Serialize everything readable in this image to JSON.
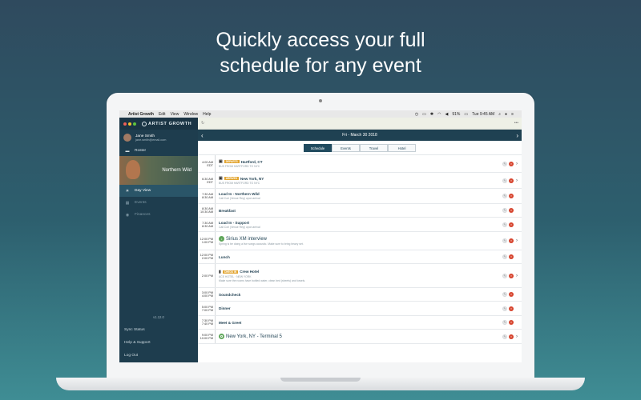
{
  "headline": {
    "line1": "Quickly access your full",
    "line2": "schedule for any event"
  },
  "menubar": {
    "apple": "",
    "app_name": "Artist Growth",
    "items": [
      "Edit",
      "View",
      "Window",
      "Help"
    ],
    "battery": "91%",
    "clock": "Tue 9:45 AM"
  },
  "sidebar": {
    "brand": "ARTIST GROWTH",
    "traffic_lights": [
      "#ec5f57",
      "#f5bf2e",
      "#5fc43d"
    ],
    "user": {
      "name": "Jane Smith",
      "email": "jane.smith@email.com"
    },
    "roster_label": "Roster",
    "band_name": "Northern Wild",
    "nav": [
      {
        "label": "Day View",
        "icon": "sun-icon"
      },
      {
        "label": "Events",
        "icon": "calendar-icon"
      },
      {
        "label": "Finances",
        "icon": "finance-icon"
      }
    ],
    "version": "v1.12.0",
    "footer": [
      "Sync Status",
      "Help & Support",
      "Log Out"
    ]
  },
  "main": {
    "date": "Fri - March 30 2018",
    "tabs": [
      "Schedule",
      "Events",
      "Travel",
      "Hotel"
    ],
    "active_tab": "Schedule",
    "rows": [
      {
        "time1": "4:00 AM",
        "time2": "EDT",
        "icon": "bus-icon",
        "badge": "DEPARTS",
        "title": "Hartford, CT",
        "sub": "BUS FROM HARTFORD TO NYC",
        "big": false,
        "height": 22
      },
      {
        "time1": "6:30 AM",
        "time2": "EDT",
        "icon": "bus-icon",
        "badge": "ARRIVES",
        "title": "New York, NY",
        "sub": "BUS FROM HARTFORD TO NYC",
        "big": false,
        "height": 20
      },
      {
        "time1": "7:30 AM",
        "time2": "8:30 AM",
        "icon": "",
        "badge": "",
        "title": "Load In - Northern Wild",
        "sub": "Call Cori (Venue Rep) upon arrival",
        "big": false,
        "height": 19
      },
      {
        "time1": "8:30 AM",
        "time2": "10:30 AM",
        "icon": "",
        "badge": "",
        "title": "Breakfast",
        "sub": "",
        "big": false,
        "height": 17
      },
      {
        "time1": "7:30 AM",
        "time2": "8:30 AM",
        "icon": "",
        "badge": "",
        "title": "Load In - Support",
        "sub": "Call Cori (Venue Rep) upon arrival",
        "big": false,
        "height": 18
      },
      {
        "time1": "12:00 PM",
        "time2": "1:00 PM",
        "icon": "radio-icon",
        "badge": "",
        "title": "Sirius XM interview",
        "sub": "Spring is be doing a live songs acoustic. Make sure to bring heavy set.",
        "big": true,
        "height": 23
      },
      {
        "time1": "12:00 PM",
        "time2": "2:00 PM",
        "icon": "",
        "badge": "",
        "title": "Lunch",
        "sub": "",
        "big": false,
        "height": 17
      },
      {
        "time1": "2:00 PM",
        "time2": "",
        "icon": "hotel-icon",
        "badge": "CHECK IN",
        "title": "Crew Hotel",
        "sub": "ACE HOTEL · NEW YORK",
        "sub2": "Make sure the rooms have bottled water, clean bed (sheets) and towels.",
        "big": false,
        "height": 30
      },
      {
        "time1": "3:00 PM",
        "time2": "4:00 PM",
        "icon": "",
        "badge": "",
        "title": "Soundcheck",
        "sub": "",
        "big": false,
        "height": 17
      },
      {
        "time1": "5:00 PM",
        "time2": "7:00 PM",
        "icon": "",
        "badge": "",
        "title": "Dinner",
        "sub": "",
        "big": false,
        "height": 18
      },
      {
        "time1": "7:30 PM",
        "time2": "7:40 PM",
        "icon": "",
        "badge": "",
        "title": "Meet & Greet",
        "sub": "",
        "big": false,
        "height": 17
      },
      {
        "time1": "9:00 PM",
        "time2": "10:00 PM",
        "icon": "venue-icon",
        "badge": "",
        "title": "New York, NY - Terminal 5",
        "sub": "",
        "big": true,
        "height": 18
      }
    ]
  }
}
